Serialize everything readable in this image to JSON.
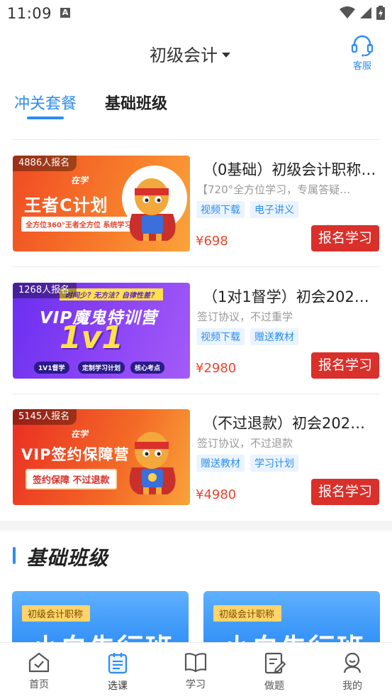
{
  "status_bar": {
    "time": "11:09",
    "a_icon": "A"
  },
  "header": {
    "title": "初级会计",
    "service_label": "客服"
  },
  "tabs": [
    {
      "label": "冲关套餐"
    },
    {
      "label": "基础班级"
    }
  ],
  "packages": [
    {
      "count": "4886人报名",
      "title": "（0基础）初级会计职称…",
      "desc": "【720°全方位学习，专属答疑…",
      "tags": [
        "视频下载",
        "电子讲义"
      ],
      "price": "¥698",
      "button": "报名学习",
      "banner": {
        "brand": "在学",
        "main": "王者C计划",
        "sub": "全方位360°王者全方位 系统学习"
      }
    },
    {
      "count": "1268人报名",
      "title": "（1对1督学）初会202…",
      "desc": "签订协议，不过重学",
      "tags": [
        "视频下载",
        "赠送教材"
      ],
      "price": "¥2980",
      "button": "报名学习",
      "banner": {
        "topline": "时间少？无方法？自律性差？",
        "main": "VIP魔鬼特训营",
        "big": "1v1",
        "pills": [
          "1V1督学",
          "定制学习计划",
          "核心考点"
        ]
      }
    },
    {
      "count": "5145人报名",
      "title": "（不过退款）初会202…",
      "desc": "签订协议，不过退款",
      "tags": [
        "赠送教材",
        "学习计划"
      ],
      "price": "¥4980",
      "button": "报名学习",
      "banner": {
        "brand": "在学",
        "main": "VIP签约保障营",
        "sub": "签约保障 不过退款"
      }
    }
  ],
  "basic_section": {
    "title": "基础班级",
    "cards": [
      {
        "tag": "初级会计职称",
        "name": "小白先行班"
      },
      {
        "tag": "初级会计职称",
        "name": "小白先行班"
      }
    ]
  },
  "bottom_nav": [
    {
      "label": "首页",
      "icon": "home-icon"
    },
    {
      "label": "选课",
      "icon": "course-select-icon",
      "active": true
    },
    {
      "label": "学习",
      "icon": "book-icon"
    },
    {
      "label": "做题",
      "icon": "exercise-icon"
    },
    {
      "label": "我的",
      "icon": "profile-icon"
    }
  ],
  "colors": {
    "accent": "#2d8cf0",
    "price": "#e8452e",
    "signup": "#d9302b"
  }
}
